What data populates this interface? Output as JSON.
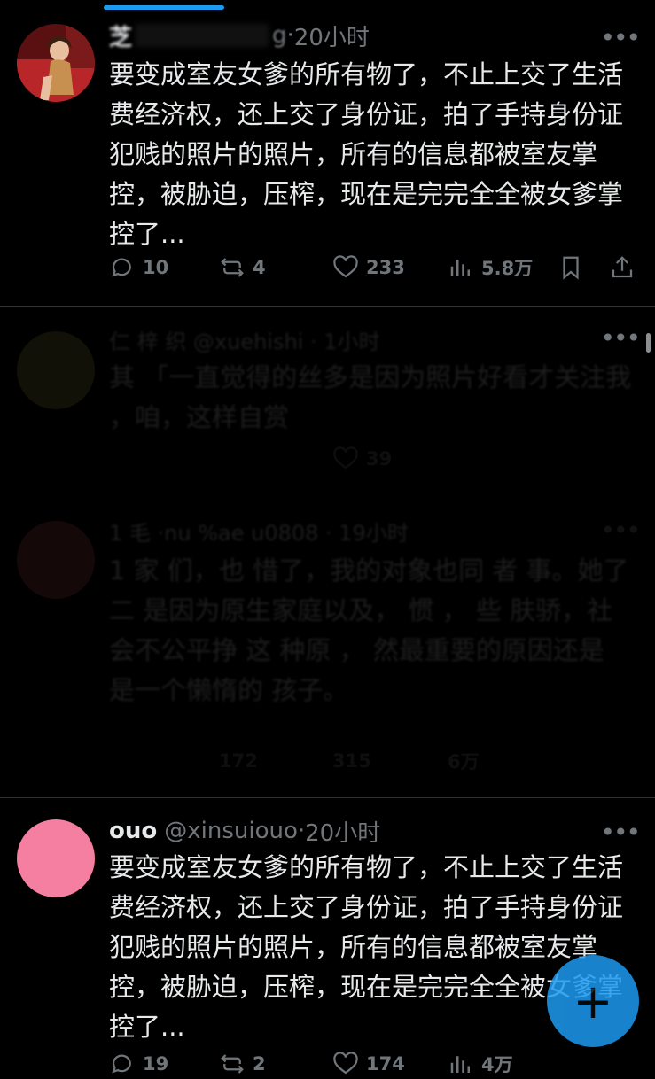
{
  "tweets": [
    {
      "name": "芝",
      "handle": "",
      "partial_handle": "g",
      "time": "20小时",
      "text": "要变成室友女爹的所有物了，不止上交了生活费经济权，还上交了身份证，拍了手持身份证犯贱的照片的照片，所有的信息都被室友掌控，被胁迫，压榨，现在是完完全全被女爹掌控了...",
      "replies": "10",
      "reposts": "4",
      "likes": "233",
      "views": "5.8万"
    },
    {
      "name": "ouo",
      "handle": "@xinsuiouo",
      "time": "20小时",
      "text": "要变成室友女爹的所有物了，不止上交了生活费经济权，还上交了身份证，拍了手持身份证犯贱的照片的照片，所有的信息都被室友掌控，被胁迫，压榨，现在是完完全全被女爹掌控了...",
      "replies": "19",
      "reposts": "2",
      "likes": "174",
      "views": "4万"
    }
  ],
  "dim_tweets": [
    {
      "header": "仁 梓 织 @xuehishi · 1小时",
      "text": "其 「一直觉得的丝多是因为照片好看才关注我 ，咱，这样自赏",
      "likes": "39"
    },
    {
      "header": "1   毛 ·nu   %ae  u0808 · 19小时",
      "text": "1   家  们，也  惜了，我的对象也同  者  事。她了  二  是因为原生家庭以及，   惯   ，  些  肤骄，社会不公平挣   这  种原   ，  然最重要的原因还是   是一个懒惰的  孩子。",
      "replies": "172",
      "likes": "315",
      "views": "6万"
    }
  ],
  "more_symbol": "•••",
  "dot": "·",
  "fab_symbol": "+"
}
